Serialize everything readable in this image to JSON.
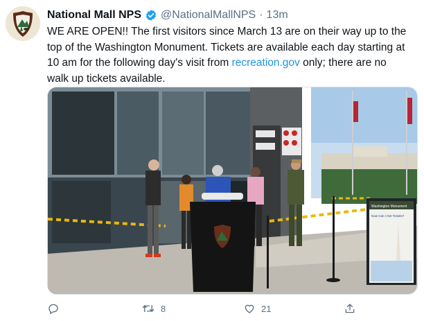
{
  "tweet": {
    "display_name": "National Mall NPS",
    "handle": "@NationalMallNPS",
    "separator": "·",
    "time": "13m",
    "text_before_link": "WE ARE OPEN!! The first visitors  since March 13 are on their way up to the top of the Washington Monument. Tickets are available each day starting at 10 am for the following day's visit from ",
    "link_text": "recreation.gov",
    "text_after_link": " only; there are no walk up tickets available."
  },
  "image": {
    "description": "Visitors in masks lining up at the Washington Monument entrance while a ranger greets them",
    "sign_title": "Washington Monument",
    "sign_subtitle": "Now Can I Get Tickets?"
  },
  "actions": {
    "reply_count": "",
    "retweet_count": "8",
    "like_count": "21"
  },
  "colors": {
    "link": "#1b95e0",
    "secondary_text": "#5b7083",
    "verified": "#1da1f2"
  },
  "icons": [
    "nps-arrowhead-logo-icon",
    "verified-badge-icon",
    "reply-icon",
    "retweet-icon",
    "like-icon",
    "share-icon"
  ]
}
